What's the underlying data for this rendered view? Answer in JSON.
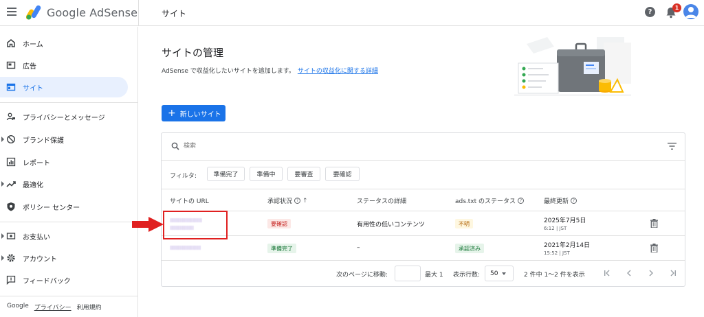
{
  "header": {
    "app_name": "Google AdSense",
    "page_crumb": "サイト",
    "help_glyph": "?",
    "notification_count": "1"
  },
  "sidebar": {
    "items": [
      {
        "label": "ホーム",
        "icon": "home-icon"
      },
      {
        "label": "広告",
        "icon": "ads-icon"
      },
      {
        "label": "サイト",
        "icon": "sites-icon",
        "active": true
      },
      {
        "label": "プライバシーとメッセージ",
        "icon": "privacy-icon"
      },
      {
        "label": "ブランド保護",
        "icon": "block-icon"
      },
      {
        "label": "レポート",
        "icon": "report-icon"
      },
      {
        "label": "最適化",
        "icon": "trend-icon"
      },
      {
        "label": "ポリシー センター",
        "icon": "policy-icon"
      },
      {
        "label": "お支払い",
        "icon": "payment-icon"
      },
      {
        "label": "アカウント",
        "icon": "gear-icon"
      },
      {
        "label": "フィードバック",
        "icon": "feedback-icon"
      }
    ],
    "footer": {
      "brand": "Google",
      "privacy": "プライバシー",
      "terms": "利用規約"
    }
  },
  "main": {
    "title": "サイトの管理",
    "description": "AdSense で収益化したいサイトを追加します。",
    "description_link": "サイトの収益化に関する詳細",
    "new_site_label": "新しいサイト",
    "new_site_glyph": "+",
    "search_placeholder": "検索",
    "filter_label": "フィルタ:",
    "filters": [
      "準備完了",
      "準備中",
      "要審査",
      "要確認"
    ],
    "columns": {
      "url": "サイトの URL",
      "approval": "承認状況",
      "detail": "ステータスの詳細",
      "ads_txt": "ads.txt のステータス",
      "updated": "最終更新"
    },
    "rows": [
      {
        "url_line1": "lllllllllllllllllllllllllll",
        "url_line2": "llllllllllllllllllll",
        "approval": "要確認",
        "detail": "有用性の低いコンテンツ",
        "ads_txt": "不明",
        "date": "2025年7月5日",
        "time": "6:12 | JST"
      },
      {
        "url_line1": "llllllllllllllllllllllllll",
        "url_line2": "",
        "approval": "準備完了",
        "detail": "–",
        "ads_txt": "承認済み",
        "date": "2021年2月14日",
        "time": "15:52 | JST"
      }
    ],
    "pager": {
      "goto_label": "次のページに移動:",
      "max_label": "最大 1",
      "rows_label": "表示行数:",
      "rows_value": "50",
      "range_label": "2 件中 1〜2 件を表示"
    }
  },
  "colors": {
    "accent": "#1a73e8",
    "highlight": "#e02020"
  }
}
